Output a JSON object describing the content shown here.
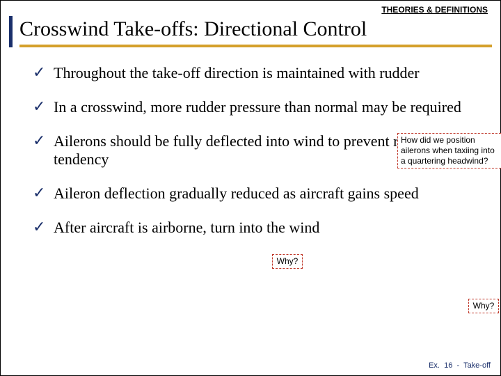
{
  "header": {
    "label": "THEORIES & DEFINITIONS"
  },
  "title": "Crosswind Take-offs: Directional Control",
  "bullets": [
    "Throughout the take-off direction is maintained with rudder",
    "In a crosswind, more rudder pressure than normal may be required",
    "Ailerons should be fully deflected into wind to prevent rolling tendency",
    "Aileron deflection gradually reduced as aircraft gains speed",
    "After aircraft is airborne, turn into the wind"
  ],
  "callouts": {
    "c1": "How did we position ailerons when taxiing into a quartering headwind?",
    "c2": "Why?",
    "c3": "Why?"
  },
  "footer": {
    "prefix": "Ex.",
    "page": "16",
    "sep": "-",
    "topic": "Take-off"
  }
}
